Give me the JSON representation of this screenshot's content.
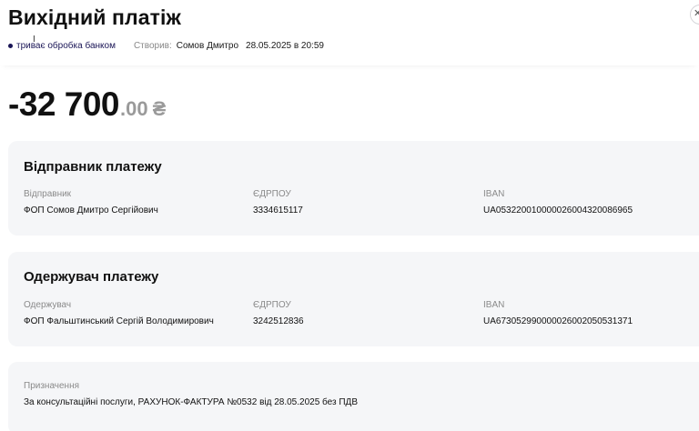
{
  "header": {
    "title": "Вихідний платіж",
    "status": "триває обробка банком",
    "created_label": "Створив:",
    "created_by": "Сомов Дмитро",
    "created_at": "28.05.2025 в 20:59",
    "close_icon": "close-icon"
  },
  "amount": {
    "main": "-32 700",
    "cents": ".00",
    "currency": "₴"
  },
  "sender": {
    "title": "Відправник платежу",
    "name_label": "Відправник",
    "name": "ФОП Сомов Дмитро Сергійович",
    "edrpou_label": "ЄДРПОУ",
    "edrpou": "3334615117",
    "iban_label": "IBAN",
    "iban": "UA053220010000026004320086965"
  },
  "recipient": {
    "title": "Одержувач платежу",
    "name_label": "Одержувач",
    "name": "ФОП Фальштинський Сергій Володимирович",
    "edrpou_label": "ЄДРПОУ",
    "edrpou": "3242512836",
    "iban_label": "IBAN",
    "iban": "UA673052990000026002050531371"
  },
  "purpose": {
    "label": "Призначення",
    "text": "За консультаційні послуги, РАХУНОК-ФАКТУРА №0532 від 28.05.2025 без ПДВ"
  },
  "colors": {
    "status_dot": "#1a1556",
    "card_bg": "#f5f6f8",
    "muted": "#8a8a8a"
  }
}
